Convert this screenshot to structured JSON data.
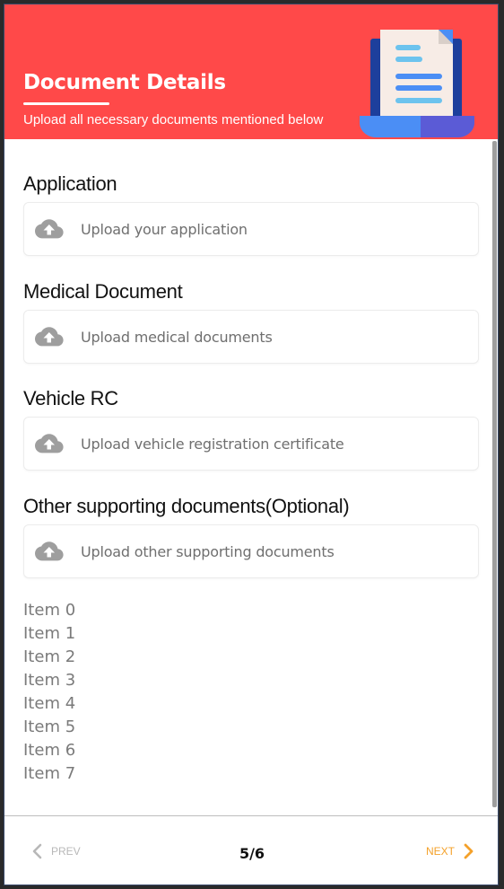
{
  "header": {
    "title": "Document Details",
    "subtitle": "Upload all necessary documents mentioned below",
    "background_color": "#ff4949",
    "illustration_icon": "document-on-laptop-illustration"
  },
  "sections": [
    {
      "title": "Application",
      "upload_placeholder": "Upload your application",
      "icon": "cloud-upload-icon"
    },
    {
      "title": "Medical Document",
      "upload_placeholder": "Upload medical documents",
      "icon": "cloud-upload-icon"
    },
    {
      "title": "Vehicle RC",
      "upload_placeholder": "Upload vehicle registration certificate",
      "icon": "cloud-upload-icon"
    },
    {
      "title": "Other supporting documents(Optional)",
      "upload_placeholder": "Upload other supporting documents",
      "icon": "cloud-upload-icon"
    }
  ],
  "items": [
    "Item 0",
    "Item 1",
    "Item 2",
    "Item 3",
    "Item 4",
    "Item 5",
    "Item 6",
    "Item 7"
  ],
  "footer": {
    "prev_label": "PREV",
    "next_label": "NEXT",
    "page_indicator": "5/6",
    "prev_color": "#b8b8b8",
    "next_color": "#f4a12a"
  }
}
